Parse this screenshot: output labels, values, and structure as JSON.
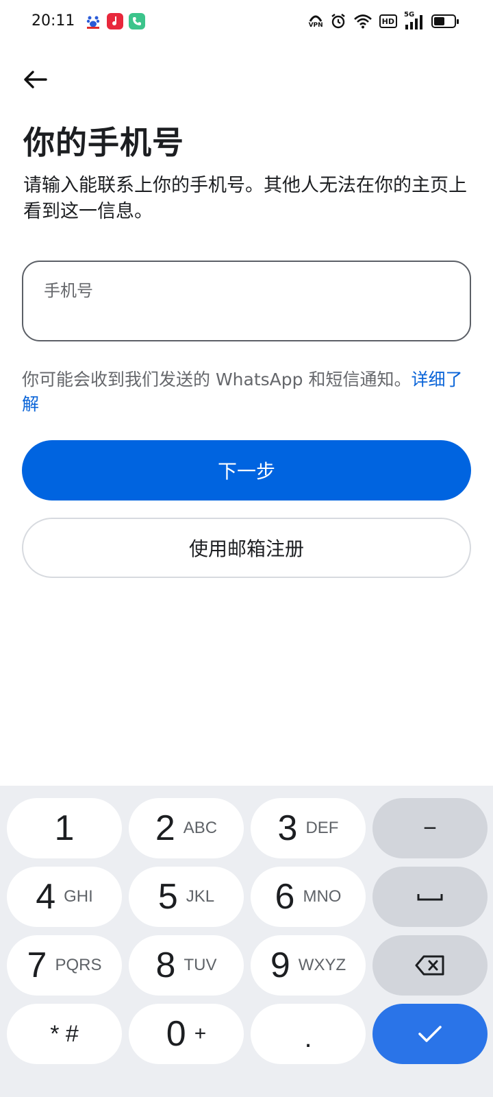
{
  "status_bar": {
    "time": "20:11",
    "app_icons": [
      "baidu-icon",
      "music-icon",
      "phone-icon"
    ],
    "system_icons": [
      "vpn-icon",
      "alarm-icon",
      "wifi-icon",
      "hd-icon",
      "5g-signal-icon",
      "battery-icon"
    ],
    "vpn_label": "VPN",
    "hd_label": "HD",
    "network_label": "5G",
    "battery_level": 0.55
  },
  "page": {
    "title": "你的手机号",
    "description": "请输入能联系上你的手机号。其他人无法在你的主页上看到这一信息。",
    "phone_placeholder": "手机号",
    "phone_value": "",
    "notice_text": "你可能会收到我们发送的 WhatsApp 和短信通知。",
    "notice_link": "详细了解",
    "next_label": "下一步",
    "email_label": "使用邮箱注册"
  },
  "keyboard": {
    "keys": [
      {
        "digit": "1",
        "letters": ""
      },
      {
        "digit": "2",
        "letters": "ABC"
      },
      {
        "digit": "3",
        "letters": "DEF"
      },
      {
        "digit": "4",
        "letters": "GHI"
      },
      {
        "digit": "5",
        "letters": "JKL"
      },
      {
        "digit": "6",
        "letters": "MNO"
      },
      {
        "digit": "7",
        "letters": "PQRS"
      },
      {
        "digit": "8",
        "letters": "TUV"
      },
      {
        "digit": "9",
        "letters": "WXYZ"
      },
      {
        "digit": "0",
        "letters": "+"
      }
    ],
    "star_hash": "* #",
    "dot": ".",
    "minus": "−",
    "icons": [
      "space-icon",
      "backspace-icon",
      "check-icon"
    ]
  },
  "colors": {
    "primary": "#0064e0",
    "link": "#0a64d8",
    "confirm_key": "#2a74e8",
    "keyboard_bg": "#eceef2"
  }
}
